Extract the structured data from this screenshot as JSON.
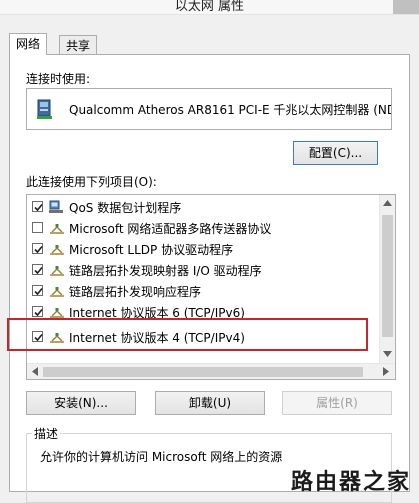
{
  "window": {
    "title": "以太网 属性"
  },
  "tabs": [
    {
      "label": "网络",
      "active": true
    },
    {
      "label": "共享",
      "active": false
    }
  ],
  "connect_using": {
    "label": "连接时使用:",
    "adapter": "Qualcomm Atheros AR8161 PCI-E 千兆以太网控制器 (NDIS",
    "configure_button": "配置(C)..."
  },
  "items_section": {
    "label": "此连接使用下列项目(O):",
    "items": [
      {
        "label": "QoS 数据包计划程序",
        "checked": true,
        "icon": "qos-icon"
      },
      {
        "label": "Microsoft 网络适配器多路传送器协议",
        "checked": false,
        "icon": "protocol-icon"
      },
      {
        "label": "Microsoft LLDP 协议驱动程序",
        "checked": true,
        "icon": "protocol-icon"
      },
      {
        "label": "链路层拓扑发现映射器 I/O 驱动程序",
        "checked": true,
        "icon": "protocol-icon"
      },
      {
        "label": "链路层拓扑发现响应程序",
        "checked": true,
        "icon": "protocol-icon"
      },
      {
        "label": "Internet 协议版本 6 (TCP/IPv6)",
        "checked": true,
        "icon": "protocol-icon"
      },
      {
        "label": "Internet 协议版本 4 (TCP/IPv4)",
        "checked": true,
        "icon": "protocol-icon"
      }
    ]
  },
  "buttons": {
    "install": "安装(N)...",
    "uninstall": "卸载(U)",
    "properties": "属性(R)"
  },
  "description": {
    "label": "描述",
    "text": "允许你的计算机访问 Microsoft 网络上的资源"
  },
  "watermark": "路由器之家",
  "colors": {
    "highlight": "#c1272d",
    "focus_border": "#3c7fb1"
  }
}
